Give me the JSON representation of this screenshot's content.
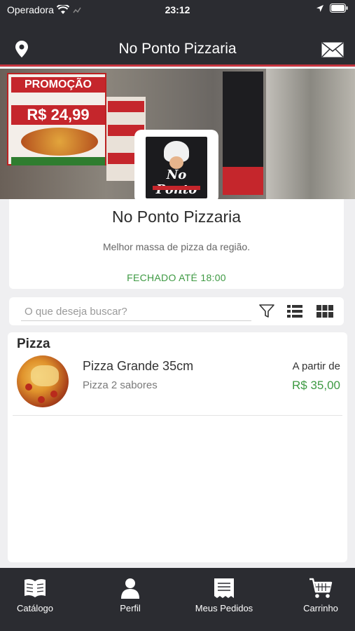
{
  "status_bar": {
    "carrier": "Operadora",
    "time": "23:12"
  },
  "nav": {
    "title": "No Ponto Pizzaria",
    "location_icon": "location-pin-icon",
    "mail_icon": "mail-icon"
  },
  "store": {
    "name": "No Ponto Pizzaria",
    "description": "Melhor massa de pizza da região.",
    "status": "FECHADO ATÉ 18:00",
    "logo_text": "No Ponto"
  },
  "banner": {
    "poster_headline": "PROMOÇÃO",
    "poster_price": "R$ 24,99"
  },
  "search": {
    "placeholder": "O que deseja buscar?"
  },
  "catalog": {
    "section_title": "Pizza",
    "items": [
      {
        "name": "Pizza Grande 35cm",
        "subtitle": "Pizza 2 sabores",
        "price_prefix": "A partir de",
        "price": "R$ 35,00"
      }
    ]
  },
  "tabs": [
    {
      "label": "Catálogo",
      "icon": "book-icon"
    },
    {
      "label": "Perfil",
      "icon": "user-icon"
    },
    {
      "label": "Meus Pedidos",
      "icon": "receipt-icon"
    },
    {
      "label": "Carrinho",
      "icon": "cart-icon"
    }
  ],
  "colors": {
    "bar_bg": "#2b2c31",
    "accent_red": "#c6343f",
    "status_green": "#3e9a43"
  }
}
